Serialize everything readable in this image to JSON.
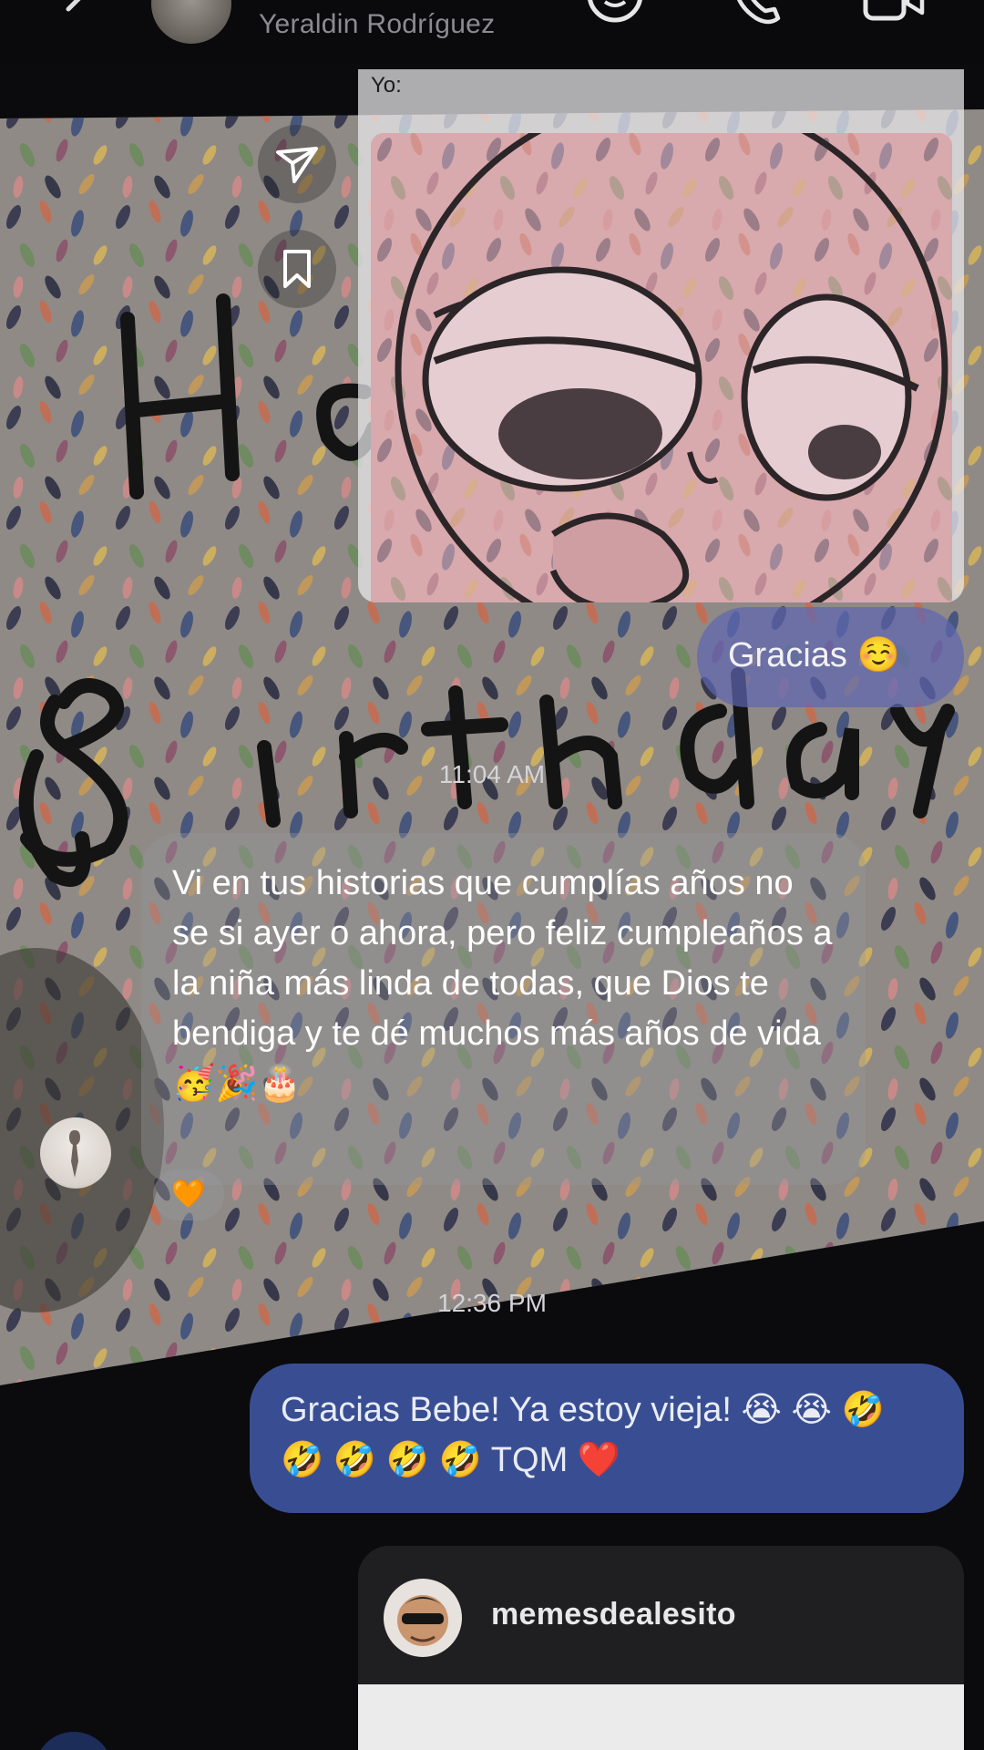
{
  "header": {
    "subtitle": "Yeraldin Rodríguez",
    "icons": [
      "back-icon",
      "sticker-icon",
      "call-icon",
      "video-icon"
    ]
  },
  "reply": {
    "label": "Yo:"
  },
  "side_actions": {
    "icons": [
      "share-icon",
      "bookmark-icon"
    ]
  },
  "messages": {
    "sent_1": "Gracias ☺️",
    "timestamp_1": "11:04 AM",
    "received_1": "Vi en tus historias que cumplías años no se si ayer o ahora, pero feliz cumpleaños a la niña más linda de todas, que Dios te bendiga y te dé muchos más años de vida 🥳🎉🎂",
    "reaction": "🧡",
    "timestamp_2": "12:36 PM",
    "sent_2": "Gracias Bebe! Ya estoy vieja! 😭 😭 🤣 🤣 🤣 🤣 🤣 TQM ❤️"
  },
  "shared_post": {
    "username": "memesdealesito"
  },
  "colors": {
    "sent_bubble": "#425aaa",
    "received_bubble": "#96969c",
    "header_bg": "#0a0a0c"
  }
}
